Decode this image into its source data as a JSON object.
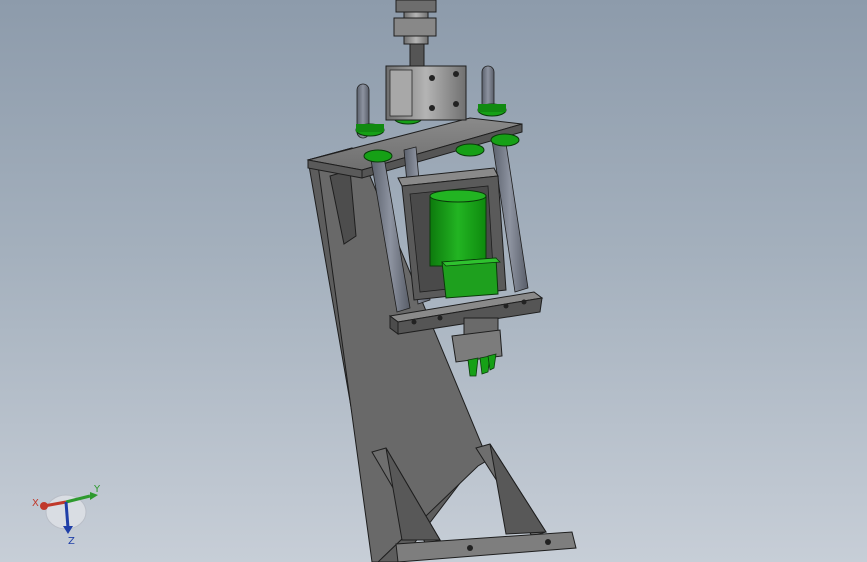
{
  "viewport": {
    "background_top": "#8d9bab",
    "background_bottom": "#c7ced7"
  },
  "model": {
    "part_color": "#6b6b6b",
    "edge_color": "#1e1e1e",
    "accent_color": "#16a016",
    "rod_color": "#6e7482"
  },
  "triad": {
    "x_label": "X",
    "y_label": "Y",
    "z_label": "Z",
    "x_color": "#c0392b",
    "y_color": "#2e9a2e",
    "z_color": "#1f3fa8"
  }
}
